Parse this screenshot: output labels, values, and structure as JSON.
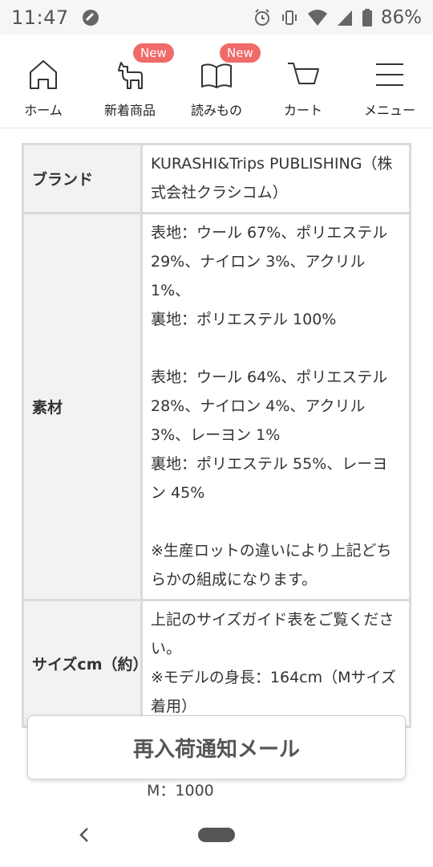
{
  "status_bar": {
    "time": "11:47",
    "battery": "86%"
  },
  "nav": {
    "items": [
      {
        "label": "ホーム",
        "icon": "home-icon"
      },
      {
        "label": "新着商品",
        "icon": "horse-icon",
        "badge": "New"
      },
      {
        "label": "読みもの",
        "icon": "book-icon",
        "badge": "New"
      },
      {
        "label": "カート",
        "icon": "cart-icon"
      },
      {
        "label": "メニュー",
        "icon": "menu-icon"
      }
    ]
  },
  "table": {
    "brand": {
      "label": "ブランド",
      "value": "KURASHI&Trips PUBLISHING（株式会社クラシコム）"
    },
    "material": {
      "label": "素材",
      "lines": [
        "表地：ウール 67%、ポリエステル 29%、ナイロン 3%、アクリル 1%、",
        "裏地：ポリエステル 100%",
        "",
        "表地：ウール 64%、ポリエステル 28%、ナイロン 4%、アクリル 3%、レーヨン 1%",
        "裏地：ポリエステル 55%、レーヨン 45%",
        "",
        "※生産ロットの違いにより上記どちらかの組成になります。"
      ]
    },
    "size": {
      "label": "サイズcm（約）",
      "lines": [
        "上記のサイズガイド表をご覧ください。",
        "※モデルの身長：164cm（Mサイズ着用）"
      ]
    },
    "cut_text": "M：1000"
  },
  "restock_button": {
    "label": "再入荷通知メール"
  }
}
